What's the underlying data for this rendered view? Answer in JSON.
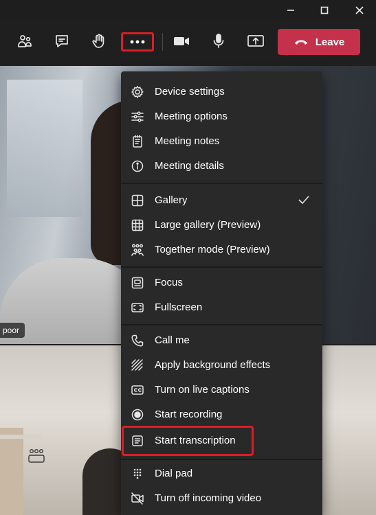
{
  "window_controls": {
    "minimize_icon": "minimize-icon",
    "maximize_icon": "maximize-icon",
    "close_icon": "close-icon"
  },
  "toolbar": {
    "buttons": [
      {
        "icon": "people-icon"
      },
      {
        "icon": "chat-icon"
      },
      {
        "icon": "raise-hand-icon"
      },
      {
        "icon": "more-actions-icon"
      },
      {
        "icon": "camera-icon"
      },
      {
        "icon": "microphone-icon"
      },
      {
        "icon": "share-screen-icon"
      }
    ],
    "leave_label": "Leave",
    "accent_color": "#c4314b",
    "highlight_color": "#d91f26"
  },
  "video": {
    "participant_name_partial": "poor"
  },
  "menu": {
    "sections": [
      {
        "items": [
          {
            "label": "Device settings",
            "icon": "gear-icon"
          },
          {
            "label": "Meeting options",
            "icon": "sliders-icon"
          },
          {
            "label": "Meeting notes",
            "icon": "notes-icon"
          },
          {
            "label": "Meeting details",
            "icon": "info-icon"
          }
        ]
      },
      {
        "items": [
          {
            "label": "Gallery",
            "icon": "gallery-icon",
            "checked": true
          },
          {
            "label": "Large gallery (Preview)",
            "icon": "large-gallery-icon"
          },
          {
            "label": "Together mode (Preview)",
            "icon": "together-mode-icon"
          }
        ]
      },
      {
        "items": [
          {
            "label": "Focus",
            "icon": "focus-icon"
          },
          {
            "label": "Fullscreen",
            "icon": "fullscreen-icon"
          }
        ]
      },
      {
        "items": [
          {
            "label": "Call me",
            "icon": "phone-icon"
          },
          {
            "label": "Apply background effects",
            "icon": "background-effects-icon"
          },
          {
            "label": "Turn on live captions",
            "icon": "captions-icon"
          },
          {
            "label": "Start recording",
            "icon": "record-icon"
          },
          {
            "label": "Start transcription",
            "icon": "transcription-icon",
            "highlighted": true
          }
        ]
      },
      {
        "items": [
          {
            "label": "Dial pad",
            "icon": "dialpad-icon"
          },
          {
            "label": "Turn off incoming video",
            "icon": "video-off-icon"
          }
        ]
      }
    ]
  }
}
